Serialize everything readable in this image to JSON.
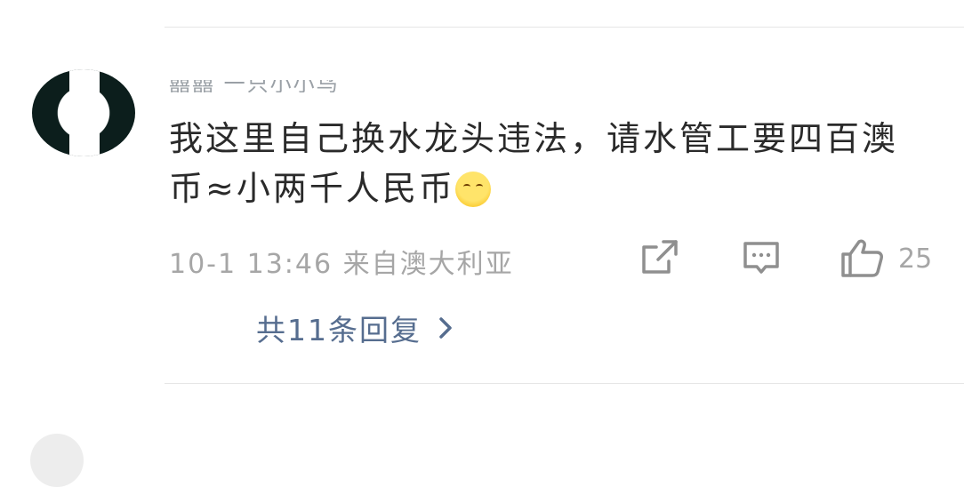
{
  "comment": {
    "username": "囍囍 一只小小鸟",
    "text": "我这里自己换水龙头违法，请水管工要四百澳币≈小两千人民币",
    "emoji": "hugging-face-emoji",
    "timestamp": "10-1 13:46",
    "location": "来自澳大利亚",
    "like_count": "25",
    "replies_label": "共11条回复"
  },
  "icons": {
    "share": "share-icon",
    "comment": "comment-icon",
    "like": "thumbs-up-icon",
    "chevron": "chevron-right-icon"
  },
  "colors": {
    "text": "#2a2a2a",
    "meta": "#a6a6a6",
    "icon": "#8f8f8f",
    "link": "#566d8f"
  }
}
